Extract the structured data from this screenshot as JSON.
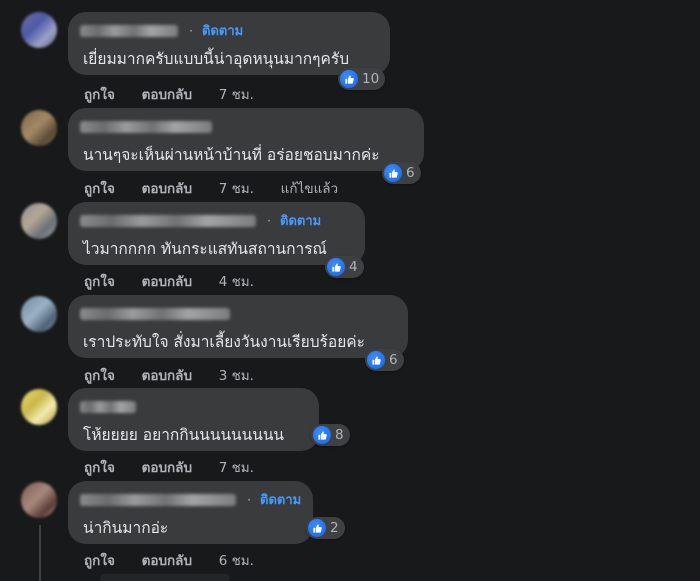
{
  "comments": [
    {
      "follow_label": "ติดตาม",
      "text": "เยี่ยมมากครับแบบนี้น่าอุดหนุนมากๆครับ",
      "reaction_count": "10",
      "actions": {
        "like": "ถูกใจ",
        "reply": "ตอบกลับ",
        "time": "7 ชม.",
        "edited": ""
      }
    },
    {
      "follow_label": "",
      "text": "นานๆจะเห็นผ่านหน้าบ้านที่ อร่อยชอบมากค่ะ",
      "reaction_count": "6",
      "actions": {
        "like": "ถูกใจ",
        "reply": "ตอบกลับ",
        "time": "7 ชม.",
        "edited": "แก้ไขแล้ว"
      }
    },
    {
      "follow_label": "ติดตาม",
      "text": "ไวมากกกก ทันกระแสทันสถานการณ์",
      "reaction_count": "4",
      "actions": {
        "like": "ถูกใจ",
        "reply": "ตอบกลับ",
        "time": "4 ชม.",
        "edited": ""
      }
    },
    {
      "follow_label": "",
      "text": "เราประทับใจ สั่งมาเลี้ยงวันงานเรียบร้อยค่ะ",
      "reaction_count": "6",
      "actions": {
        "like": "ถูกใจ",
        "reply": "ตอบกลับ",
        "time": "3 ชม.",
        "edited": ""
      }
    },
    {
      "follow_label": "",
      "text": "โห้ยยยย อยากกินนนนนนนนน",
      "reaction_count": "8",
      "actions": {
        "like": "ถูกใจ",
        "reply": "ตอบกลับ",
        "time": "7 ชม.",
        "edited": ""
      }
    },
    {
      "follow_label": "ติดตาม",
      "text": "น่ากินมากอ่ะ",
      "reaction_count": "2",
      "actions": {
        "like": "ถูกใจ",
        "reply": "ตอบกลับ",
        "time": "6 ชม.",
        "edited": ""
      }
    }
  ],
  "colors": {
    "background": "#18191a",
    "bubble": "#3a3b3c",
    "text": "#e4e6eb",
    "secondary_text": "#b0b3b8",
    "link_blue": "#4599ff",
    "like_blue": "#1877f2"
  },
  "icons": {
    "reaction": "like-thumbs-up-icon",
    "avatar": "blurred-avatar"
  }
}
